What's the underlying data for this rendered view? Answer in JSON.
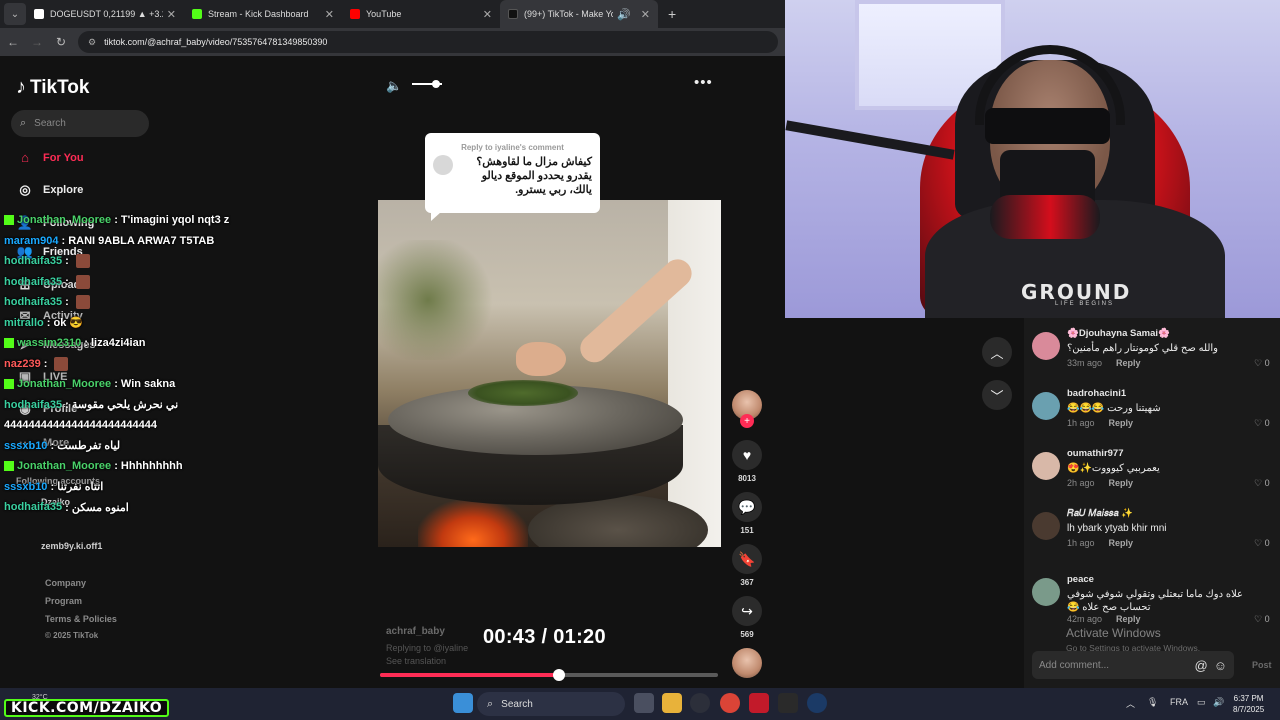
{
  "browser": {
    "tabs": [
      {
        "label": "DOGEUSDT 0,21199 ▲ +3.29%",
        "color": "#ffffff"
      },
      {
        "label": "Stream - Kick Dashboard",
        "color": "#53fc18"
      },
      {
        "label": "YouTube",
        "color": "#ff0000"
      },
      {
        "label": "(99+) TikTok - Make Your Da",
        "color": "#111111"
      }
    ],
    "url": "tiktok.com/@achraf_baby/video/7535764781349850390"
  },
  "tiktok": {
    "logo": "TikTok",
    "search_placeholder": "Search",
    "nav": {
      "for_you": "For You",
      "explore": "Explore",
      "following": "Following",
      "friends": "Friends",
      "upload": "Upload",
      "activity": "Activity",
      "messages": "Messages",
      "live": "LIVE",
      "profile": "Profile",
      "more": "More"
    },
    "following_accounts": "Following accounts",
    "followed": [
      {
        "name": "Dzaiko"
      },
      {
        "name": "zemb9y.ki.off1"
      }
    ],
    "footer": {
      "company": "Company",
      "program": "Program",
      "terms": "Terms & Policies",
      "copyright": "© 2025 TikTok"
    }
  },
  "chat": [
    {
      "user": "Jonathan_Mooree",
      "color": "#4ad26a",
      "badge": true,
      "text": " : T'imagini yqol nqt3 z"
    },
    {
      "user": "maram904",
      "color": "#1aa9ff",
      "badge": false,
      "text": " : RANI 9ABLA ARWA7 T5TAB"
    },
    {
      "user": "hodhaifa35",
      "color": "#3ad0a0",
      "badge": false,
      "text": " : ",
      "emote": true
    },
    {
      "user": "hodhaifa35",
      "color": "#3ad0a0",
      "badge": false,
      "text": " : ",
      "emote": true
    },
    {
      "user": "hodhaifa35",
      "color": "#3ad0a0",
      "badge": false,
      "text": " : ",
      "emote": true
    },
    {
      "user": "mitrallo",
      "color": "#3ad0a0",
      "badge": false,
      "text": " : ok 😎"
    },
    {
      "user": "wassim2310",
      "color": "#4ad26a",
      "badge": true,
      "text": " : liza4zi4ian"
    },
    {
      "user": "naz239",
      "color": "#ff5a5a",
      "badge": false,
      "text": " : ",
      "emote": true
    },
    {
      "user": "Jonathan_Mooree",
      "color": "#4ad26a",
      "badge": true,
      "text": " : Win sakna"
    },
    {
      "user": "hodhaifa35",
      "color": "#3ad0a0",
      "badge": false,
      "text": " : ني نحرش يلحي مقوسة"
    },
    {
      "user": "",
      "color": "#ffffff",
      "badge": false,
      "text": "4444444444444444444444444"
    },
    {
      "user": "sssxb10",
      "color": "#1aa9ff",
      "badge": false,
      "text": " : لياه تفرطست"
    },
    {
      "user": "Jonathan_Mooree",
      "color": "#4ad26a",
      "badge": true,
      "text": " : Hhhhhhhhh"
    },
    {
      "user": "sssxb10",
      "color": "#1aa9ff",
      "badge": false,
      "text": " : اتتاه نفرتنا"
    },
    {
      "user": "hodhaifa35",
      "color": "#3ad0a0",
      "badge": false,
      "text": " : امنوه مسكن"
    }
  ],
  "video": {
    "reply_header": "Reply to iyaline's comment",
    "reply_text": "كيفاش مزال ما لقاوهش؟ يقدرو يحددو الموقع ديالو يالك، ربي يسترو.",
    "author": "achraf_baby",
    "replying_to": "Replying to @iyaline",
    "see_translation": "See translation",
    "current_time": "00:43",
    "duration": "01:20",
    "progress": 0.53,
    "volume": 0.8,
    "likes": "8013",
    "comments": "151",
    "saves": "367",
    "shares": "569"
  },
  "webcam": {
    "shirt_text": "GROUND",
    "shirt_sub": "LIFE BEGINS"
  },
  "comments": [
    {
      "user": "🌸Djouhayna Samai🌸",
      "text": "والله صح قلي كومونتار راهم مأمنين؟",
      "rtl": true,
      "time": "33m ago",
      "reply": "Reply",
      "likes": "0",
      "avatar": "#d98a9a"
    },
    {
      "user": "badrohacini1",
      "text": "شهيتنا ورحت 😂😂😂",
      "rtl": true,
      "time": "1h ago",
      "reply": "Reply",
      "likes": "0",
      "avatar": "#6aa0b0"
    },
    {
      "user": "oumathir977",
      "text": "يعمرببي كيوووت✨😍",
      "rtl": true,
      "time": "2h ago",
      "reply": "Reply",
      "likes": "0",
      "avatar": "#d8b8a8"
    },
    {
      "user": "𝑅𝑎𝑈 𝑀𝑎𝑖𝑠𝑠𝑎 ✨",
      "text": "lh ybark ytyab khir mni",
      "rtl": false,
      "time": "1h ago",
      "reply": "Reply",
      "likes": "0",
      "avatar": "#4a3a30"
    },
    {
      "user": "peace",
      "text": "علاه دوك ماما تبعتلي وتقولي شوفي شوفي تحساب صح علاه 😂",
      "rtl": true,
      "time": "42m ago",
      "reply": "Reply",
      "likes": "0",
      "avatar": "#7a9a8a"
    }
  ],
  "windows_notice": {
    "title": "Activate Windows",
    "sub": "Go to Settings to activate Windows."
  },
  "comment_box": {
    "placeholder": "Add comment...",
    "post": "Post"
  },
  "taskbar": {
    "kick_label": "KICK.COM/DZAIKO",
    "temp": "32°C",
    "search": "Search",
    "lang": "FRA",
    "time": "6:37 PM",
    "date": "8/7/2025"
  }
}
